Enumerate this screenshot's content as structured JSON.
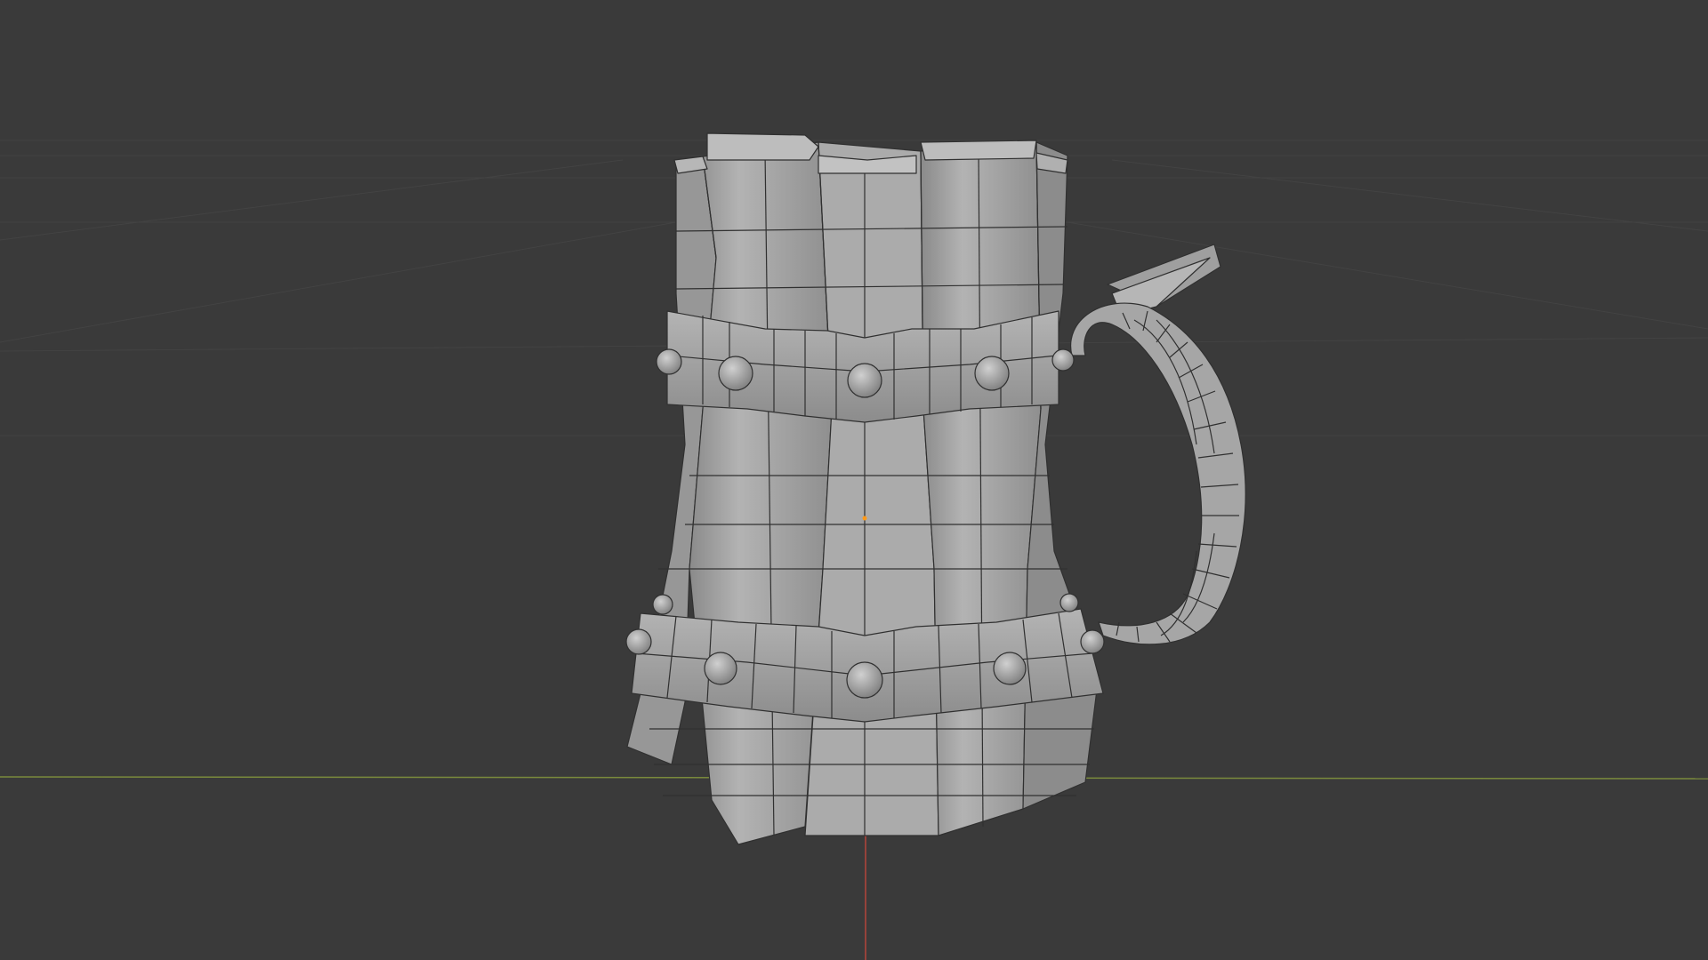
{
  "viewport": {
    "background_color": "#3a3a3a",
    "grid_color": "#444444",
    "x_axis_color": "#7a8a3c",
    "z_axis_color": "#b5453a",
    "object_origin_color": "#ff9a1a",
    "mesh_fill_color": "#a9a9a9",
    "mesh_wire_color": "#303030",
    "display_mode": "solid-with-wireframe"
  },
  "scene": {
    "object": "beer-tankard",
    "features": [
      "wooden-staves",
      "upper-metal-band",
      "lower-metal-band",
      "rivets",
      "curved-handle",
      "thumb-rest"
    ]
  }
}
